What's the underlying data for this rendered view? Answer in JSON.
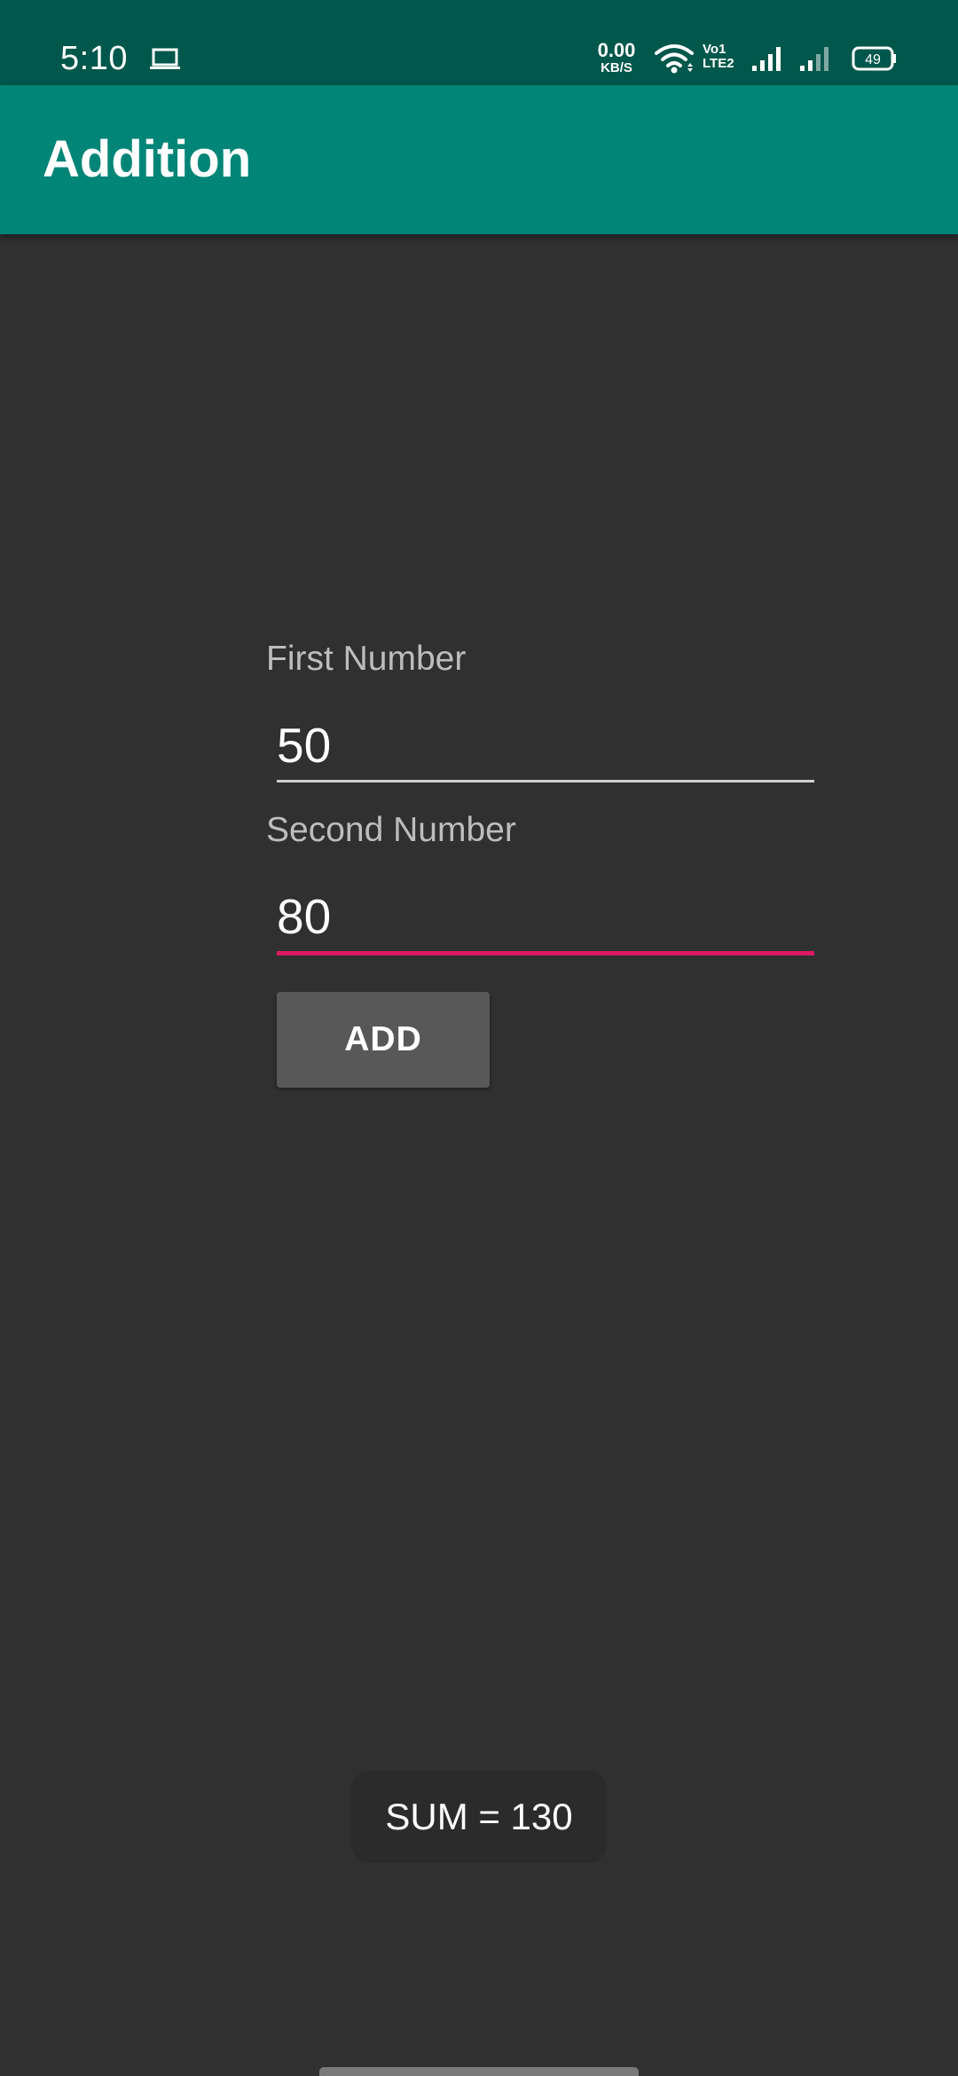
{
  "status_bar": {
    "time": "5:10",
    "net_speed_value": "0.00",
    "net_speed_unit": "KB/S",
    "volte_line1": "Vo",
    "volte_line2": "LTE",
    "sim1": "1",
    "sim2": "2",
    "battery": "49",
    "icons": [
      "laptop-icon",
      "wifi-icon",
      "volte-icon",
      "signal-icon",
      "signal-icon",
      "battery-icon"
    ],
    "color": "#00574b"
  },
  "app_bar": {
    "title": "Addition",
    "color": "#008577"
  },
  "form": {
    "first": {
      "label": "First Number",
      "value": "50"
    },
    "second": {
      "label": "Second Number",
      "value": "80"
    },
    "add_label": "ADD",
    "accent_color": "#d81b60"
  },
  "toast": {
    "message": "SUM = 130"
  },
  "theme": {
    "background": "#303030"
  }
}
